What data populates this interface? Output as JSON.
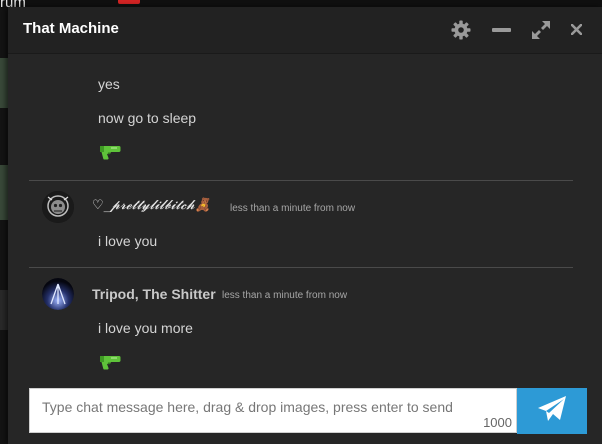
{
  "background": {
    "forum_text": "rum"
  },
  "window": {
    "title": "That Machine",
    "controls": [
      "gear-icon",
      "minimize-icon",
      "expand-icon",
      "close-icon"
    ]
  },
  "messages": [
    {
      "text": "yes"
    },
    {
      "text": "now go to sleep"
    },
    {
      "emoji": "water-pistol"
    },
    {
      "username": "♡_𝓹𝓻𝓮𝓽𝓽𝔂𝓵𝓲𝓵𝓫𝓲𝓽𝓬𝓱🧸",
      "timestamp": "less than a minute from now",
      "text": "i love you"
    },
    {
      "username": "Tripod, The Shitter",
      "timestamp": "less than a minute from now",
      "text": "i love you more"
    },
    {
      "emoji": "water-pistol"
    }
  ],
  "composer": {
    "placeholder": "Type chat message here, drag & drop images, press enter to send",
    "char_limit": "1000"
  },
  "colors": {
    "send_button": "#2d9ad6",
    "window_bg": "#262626",
    "title": "#ffffff"
  }
}
